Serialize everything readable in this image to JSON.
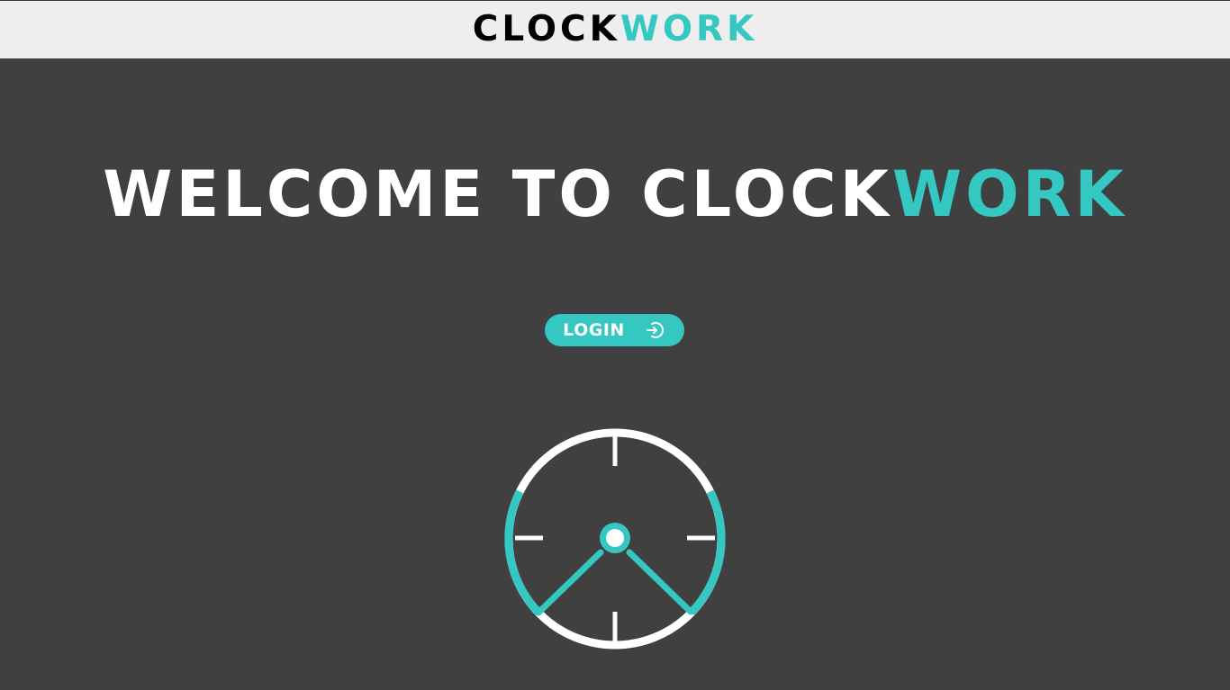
{
  "header": {
    "logo_dark": "CLOCK",
    "logo_accent": "WORK"
  },
  "hero": {
    "welcome_light": "WELCOME TO CLOCK",
    "welcome_accent": "WORK"
  },
  "login": {
    "label": "LOGIN",
    "icon": "login-arrow-icon"
  },
  "illustration": {
    "icon": "clock-icon"
  },
  "colors": {
    "accent": "#35c7c2",
    "background": "#404040",
    "header_background": "#eeeeee",
    "text_light": "#ffffff",
    "text_dark": "#000000"
  }
}
